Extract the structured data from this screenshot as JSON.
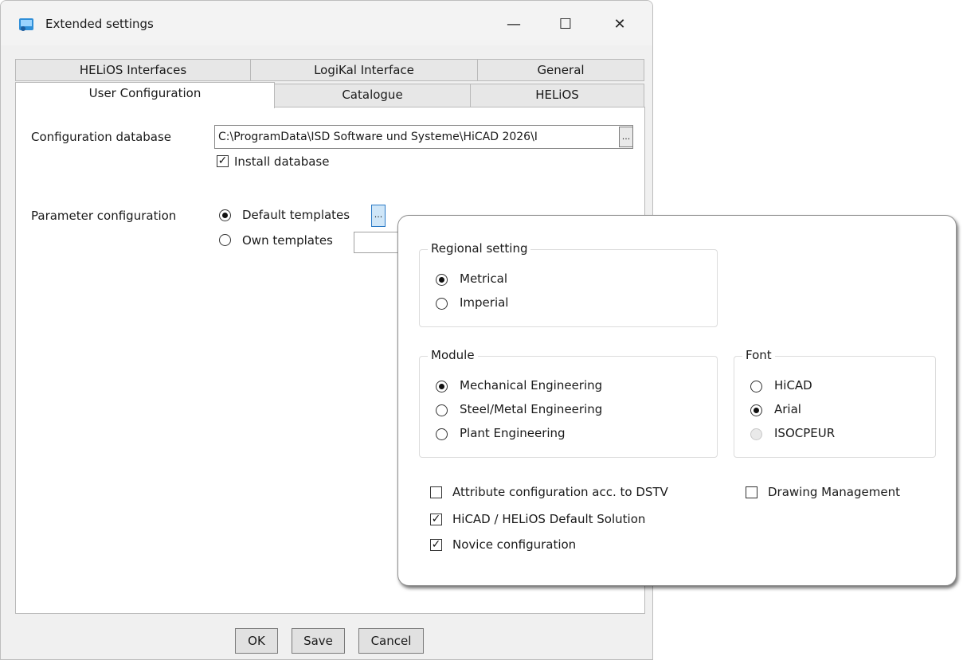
{
  "window": {
    "title": "Extended settings",
    "minimize_glyph": "—",
    "maximize_glyph": "☐",
    "close_glyph": "✕"
  },
  "tabs_row1": [
    {
      "label": "HELiOS Interfaces"
    },
    {
      "label": "LogiKal Interface"
    },
    {
      "label": "General"
    }
  ],
  "tabs_row2": [
    {
      "label": "User Configuration",
      "active": true
    },
    {
      "label": "Catalogue"
    },
    {
      "label": "HELiOS"
    }
  ],
  "user_config": {
    "config_db_label": "Configuration database",
    "config_db_path": "C:\\ProgramData\\ISD Software und Systeme\\HiCAD 2026\\I",
    "browse_label": "...",
    "install_db_label": "Install database",
    "install_db_checked": true,
    "param_config_label": "Parameter configuration",
    "default_templates_label": "Default templates",
    "own_templates_label": "Own templates",
    "selected_template": "Default templates"
  },
  "popup": {
    "regional": {
      "title": "Regional setting",
      "options": [
        "Metrical",
        "Imperial"
      ],
      "selected": "Metrical"
    },
    "module": {
      "title": "Module",
      "options": [
        "Mechanical Engineering",
        "Steel/Metal Engineering",
        "Plant Engineering"
      ],
      "selected": "Mechanical Engineering"
    },
    "font": {
      "title": "Font",
      "options": [
        "HiCAD",
        "Arial",
        "ISOCPEUR"
      ],
      "selected": "Arial",
      "disabled": [
        "ISOCPEUR"
      ]
    },
    "checkboxes": {
      "attr_dstv": {
        "label": "Attribute configuration acc. to DSTV",
        "checked": false
      },
      "default_solution": {
        "label": "HiCAD / HELiOS Default Solution",
        "checked": true
      },
      "novice": {
        "label": "Novice configuration",
        "checked": true
      },
      "drawing_mgmt": {
        "label": "Drawing Management",
        "checked": false
      }
    }
  },
  "buttons": {
    "ok": "OK",
    "save": "Save",
    "cancel": "Cancel"
  },
  "colors": {
    "highlight_button": "#cfe6f8",
    "dialog_background": "#f0f0f0"
  }
}
